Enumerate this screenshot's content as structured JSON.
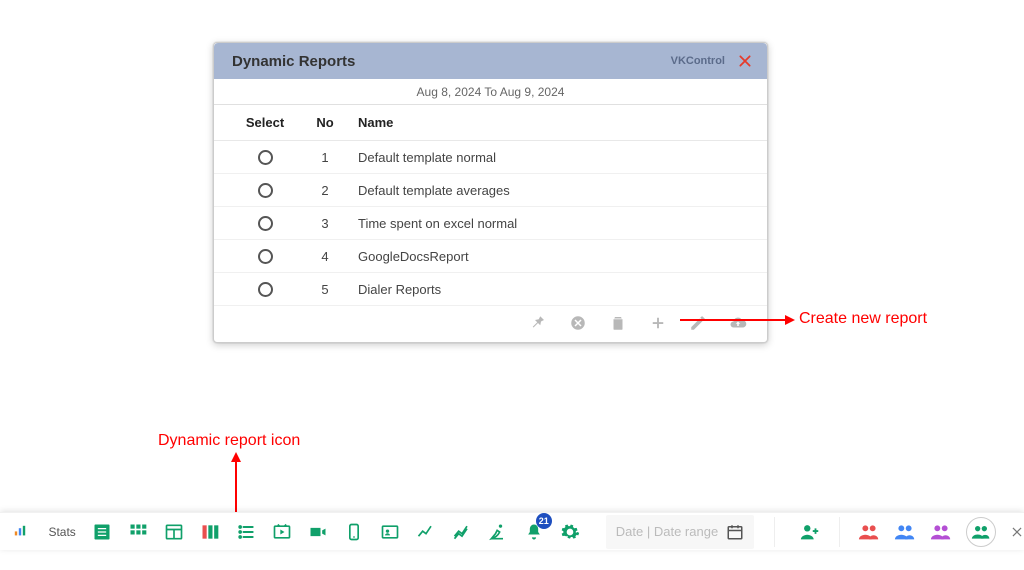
{
  "modal": {
    "title": "Dynamic Reports",
    "brand": "VKControl",
    "date_range": "Aug 8, 2024 To Aug 9, 2024",
    "columns": {
      "select": "Select",
      "no": "No",
      "name": "Name"
    },
    "rows": [
      {
        "no": "1",
        "name": "Default template normal"
      },
      {
        "no": "2",
        "name": "Default template averages"
      },
      {
        "no": "3",
        "name": "Time spent on excel normal"
      },
      {
        "no": "4",
        "name": "GoogleDocsReport"
      },
      {
        "no": "5",
        "name": "Dialer Reports"
      }
    ]
  },
  "annotations": {
    "create": "Create new report",
    "dynamic_icon": "Dynamic report icon"
  },
  "bottom": {
    "stats_label": "Stats",
    "badge_count": "21",
    "date_placeholder": "Date | Date range"
  }
}
